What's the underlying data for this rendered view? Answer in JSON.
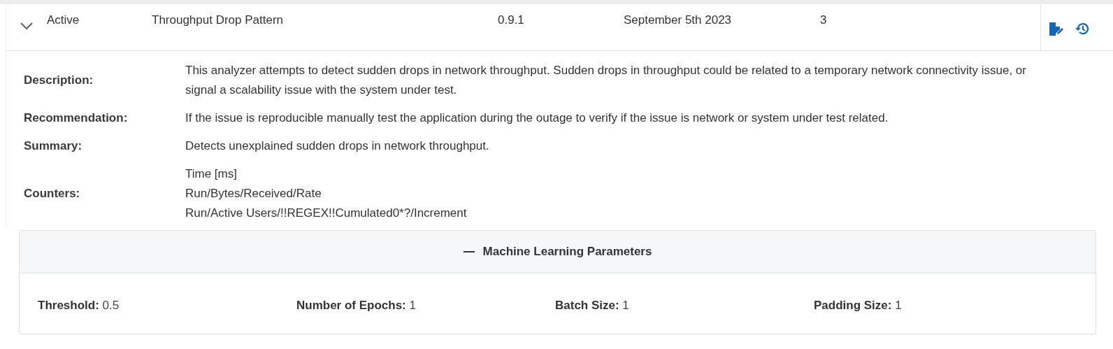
{
  "row": {
    "expanded": true,
    "status": "Active",
    "name": "Throughput Drop Pattern",
    "version": "0.9.1",
    "date": "September 5th 2023",
    "count": "3"
  },
  "details": [
    {
      "label": "Description:",
      "lines": [
        "This analyzer attempts to detect sudden drops in network throughput. Sudden drops in throughput could be related to a temporary network connectivity issue, or signal a scalability issue with the system under test."
      ]
    },
    {
      "label": "Recommendation:",
      "lines": [
        "If the issue is reproducible manually test the application during the outage to verify if the issue is network or system under test related."
      ]
    },
    {
      "label": "Summary:",
      "lines": [
        "Detects unexplained sudden drops in network throughput."
      ]
    },
    {
      "label": "Counters:",
      "lines": [
        "Time [ms]",
        "Run/Bytes/Received/Rate",
        "Run/Active Users/!!REGEX!!Cumulated0*?/Increment"
      ]
    }
  ],
  "panel": {
    "expanded": true,
    "title": "Machine Learning Parameters",
    "params": [
      {
        "label": "Threshold:",
        "value": "0.5"
      },
      {
        "label": "Number of Epochs:",
        "value": "1"
      },
      {
        "label": "Batch Size:",
        "value": "1"
      },
      {
        "label": "Padding Size:",
        "value": "1"
      }
    ]
  }
}
